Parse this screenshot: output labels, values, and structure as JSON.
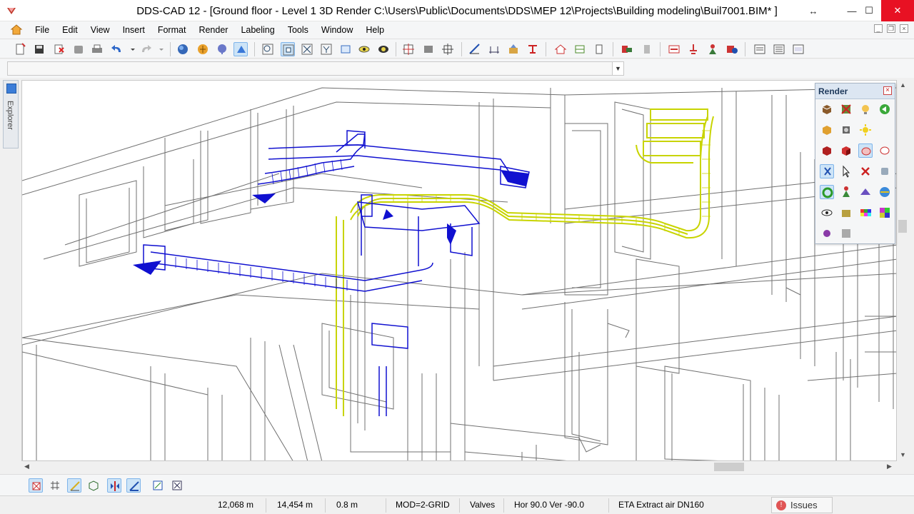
{
  "window": {
    "title": "DDS-CAD 12 - [Ground floor - Level 1  3D  Render  C:\\Users\\Public\\Documents\\DDS\\MEP 12\\Projects\\Building modeling\\Buil7001.BIM* ]",
    "minimize_glyph": "—",
    "maximize_glyph": "☐",
    "close_glyph": "✕",
    "restore_glyph": "↔"
  },
  "menu": {
    "items": [
      "File",
      "Edit",
      "View",
      "Insert",
      "Format",
      "Render",
      "Labeling",
      "Tools",
      "Window",
      "Help"
    ]
  },
  "explorer": {
    "label": "Explorer"
  },
  "render_panel": {
    "title": "Render",
    "close_glyph": "×"
  },
  "status": {
    "x_coord": "12,068 m",
    "y_coord": "14,454 m",
    "z_coord": "0.8 m",
    "grid_mode": "MOD=2-GRID",
    "layer": "Valves",
    "angle": "Hor  90.0 Ver -90.0",
    "component": "ETA Extract air DN160",
    "issues_label": "Issues",
    "issues_glyph": "!"
  },
  "colors": {
    "duct_blue": "#1010d0",
    "duct_yellow": "#c8d400",
    "wire_gray": "#707070",
    "active_bg": "#cde4f7"
  },
  "toolbar_icons": [
    "new-icon",
    "save-icon",
    "close-file-icon",
    "grey-box-icon",
    "print-icon",
    "undo-icon",
    "redo-icon",
    "sphere-icon",
    "render-icon",
    "tree-icon",
    "select-icon",
    "zoom-icon",
    "zoom-window-icon",
    "zoom-extents-icon",
    "filter-icon",
    "frame-icon",
    "eye-icon",
    "visibility-icon",
    "grid-icon",
    "block-icon",
    "align-icon",
    "measure-icon",
    "dimension-icon",
    "house-icon",
    "layers-icon",
    "column-icon",
    "component-icon",
    "stamp-icon",
    "route-icon",
    "pipe-icon",
    "valve-icon",
    "schedule-icon",
    "report-icon",
    "list-icon"
  ]
}
